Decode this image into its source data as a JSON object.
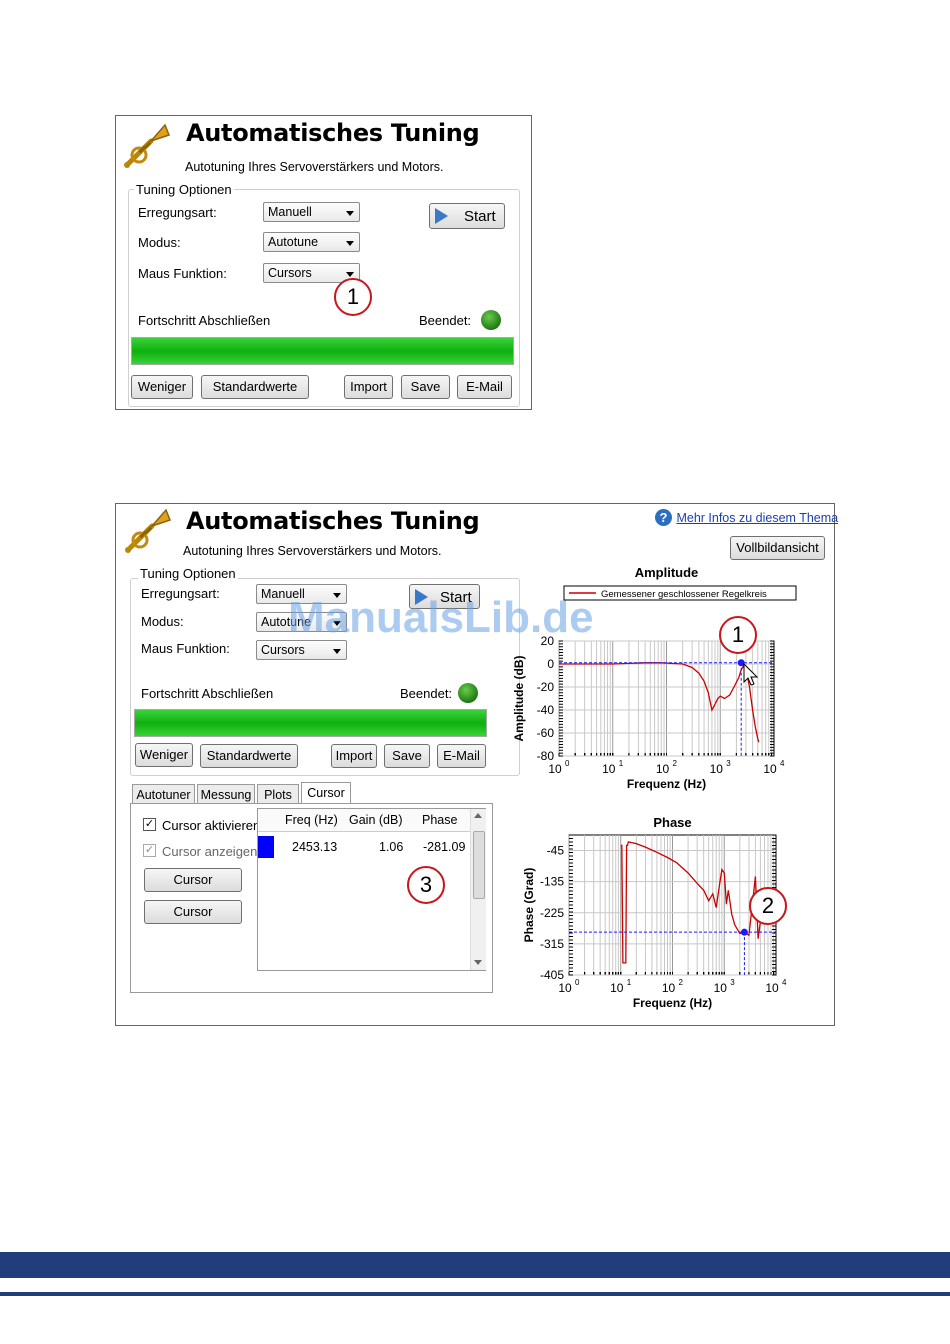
{
  "panel1": {
    "title": "Automatisches Tuning",
    "subtitle": "Autotuning Ihres Servoverstärkers und Motors.",
    "group_label": "Tuning Optionen",
    "erregungsart_label": "Erregungsart:",
    "erregungsart_value": "Manuell",
    "modus_label": "Modus:",
    "modus_value": "Autotune",
    "maus_label": "Maus Funktion:",
    "maus_value": "Cursors",
    "start_label": "Start",
    "progress_label": "Fortschritt Abschließen",
    "progress_percent": 100,
    "status_label": "Beendet:",
    "callout": "1",
    "buttons": {
      "weniger": "Weniger",
      "standard": "Standardwerte",
      "import": "Import",
      "save": "Save",
      "email": "E-Mail"
    }
  },
  "panel2": {
    "title": "Automatisches Tuning",
    "subtitle": "Autotuning Ihres Servoverstärkers und Motors.",
    "help_link": "Mehr Infos zu diesem Thema",
    "fullscreen_button": "Vollbildansicht",
    "group_label": "Tuning Optionen",
    "erregungsart_label": "Erregungsart:",
    "erregungsart_value": "Manuell",
    "modus_label": "Modus:",
    "modus_value": "Autotune",
    "maus_label": "Maus Funktion:",
    "maus_value": "Cursors",
    "start_label": "Start",
    "progress_label": "Fortschritt Abschließen",
    "progress_percent": 100,
    "status_label": "Beendet:",
    "buttons": {
      "weniger": "Weniger",
      "standard": "Standardwerte",
      "import": "Import",
      "save": "Save",
      "email": "E-Mail"
    },
    "tabs": [
      "Autotuner",
      "Messung",
      "Plots",
      "Cursor"
    ],
    "active_tab": "Cursor",
    "cursor_activate_label": "Cursor aktivieren",
    "cursor_show_label": "Cursor anzeigen",
    "cursor_button_1": "Cursor",
    "cursor_button_2": "Cursor",
    "table": {
      "headers": [
        "Freq (Hz)",
        "Gain (dB)",
        "Phase"
      ],
      "rows": [
        {
          "color": "#0000ff",
          "freq": "2453.13",
          "gain": "1.06",
          "phase": "-281.09"
        }
      ]
    },
    "callouts": [
      "1",
      "2",
      "3"
    ]
  },
  "chart_data": [
    {
      "type": "line",
      "title": "Amplitude",
      "xlabel": "Frequenz (Hz)",
      "ylabel": "Amplitude (dB)",
      "xscale": "log",
      "xlim": [
        1,
        10000
      ],
      "ylim": [
        -80,
        20
      ],
      "x_ticks": [
        "10",
        "10",
        "10",
        "10",
        "10"
      ],
      "x_tick_exponents": [
        "0",
        "1",
        "2",
        "3",
        "4"
      ],
      "y_ticks": [
        "20",
        "0",
        "-20",
        "-40",
        "-60",
        "-80"
      ],
      "grid": true,
      "legend": "top",
      "series": [
        {
          "name": "Gemessener geschlossener Regelkreis",
          "color": "#cc0000",
          "x": [
            1,
            2,
            5,
            10,
            20,
            40,
            80,
            120,
            200,
            300,
            400,
            500,
            600,
            700,
            800,
            900,
            1000,
            1200,
            1500,
            1800,
            2200,
            2453,
            2700,
            3000,
            3500,
            4000,
            4500,
            5000,
            5200
          ],
          "y": [
            0,
            0,
            0,
            0,
            0.5,
            1,
            1,
            0.5,
            0,
            -3,
            -8,
            -15,
            -25,
            -40,
            -35,
            -30,
            -28,
            -30,
            -27,
            -20,
            -12,
            -5,
            -2,
            -4,
            -20,
            -40,
            -55,
            -65,
            -68
          ]
        }
      ],
      "cursor": {
        "x": 2453.13,
        "y": 1.06
      }
    },
    {
      "type": "line",
      "title": "Phase",
      "xlabel": "Frequenz (Hz)",
      "ylabel": "Phase (Grad)",
      "xscale": "log",
      "xlim": [
        1,
        10000
      ],
      "ylim": [
        -405,
        0
      ],
      "x_ticks": [
        "10",
        "10",
        "10",
        "10",
        "10"
      ],
      "x_tick_exponents": [
        "0",
        "1",
        "2",
        "3",
        "4"
      ],
      "y_ticks": [
        "-45",
        "-135",
        "-225",
        "-315",
        "-405"
      ],
      "grid": true,
      "series": [
        {
          "name": "",
          "color": "#cc0000",
          "x": [
            10,
            10.5,
            11,
            12,
            12.5,
            13,
            13.5,
            14,
            20,
            30,
            50,
            80,
            120,
            200,
            300,
            400,
            500,
            600,
            700,
            800,
            900,
            1000,
            1100,
            1200,
            1400,
            1600,
            2000,
            2453,
            3000,
            3500,
            4000,
            4500,
            5000
          ],
          "y": [
            -30,
            -30,
            -370,
            -370,
            -370,
            -30,
            -30,
            -20,
            -25,
            -35,
            -50,
            -65,
            -80,
            -110,
            -140,
            -160,
            -190,
            -170,
            -210,
            -150,
            -100,
            -110,
            -200,
            -160,
            -230,
            -260,
            -285,
            -281.09,
            -290,
            -200,
            -120,
            -300,
            -250
          ]
        }
      ],
      "cursor": {
        "x": 2453.13,
        "y": -281.09
      }
    }
  ],
  "watermark": "ManualsLib.de"
}
